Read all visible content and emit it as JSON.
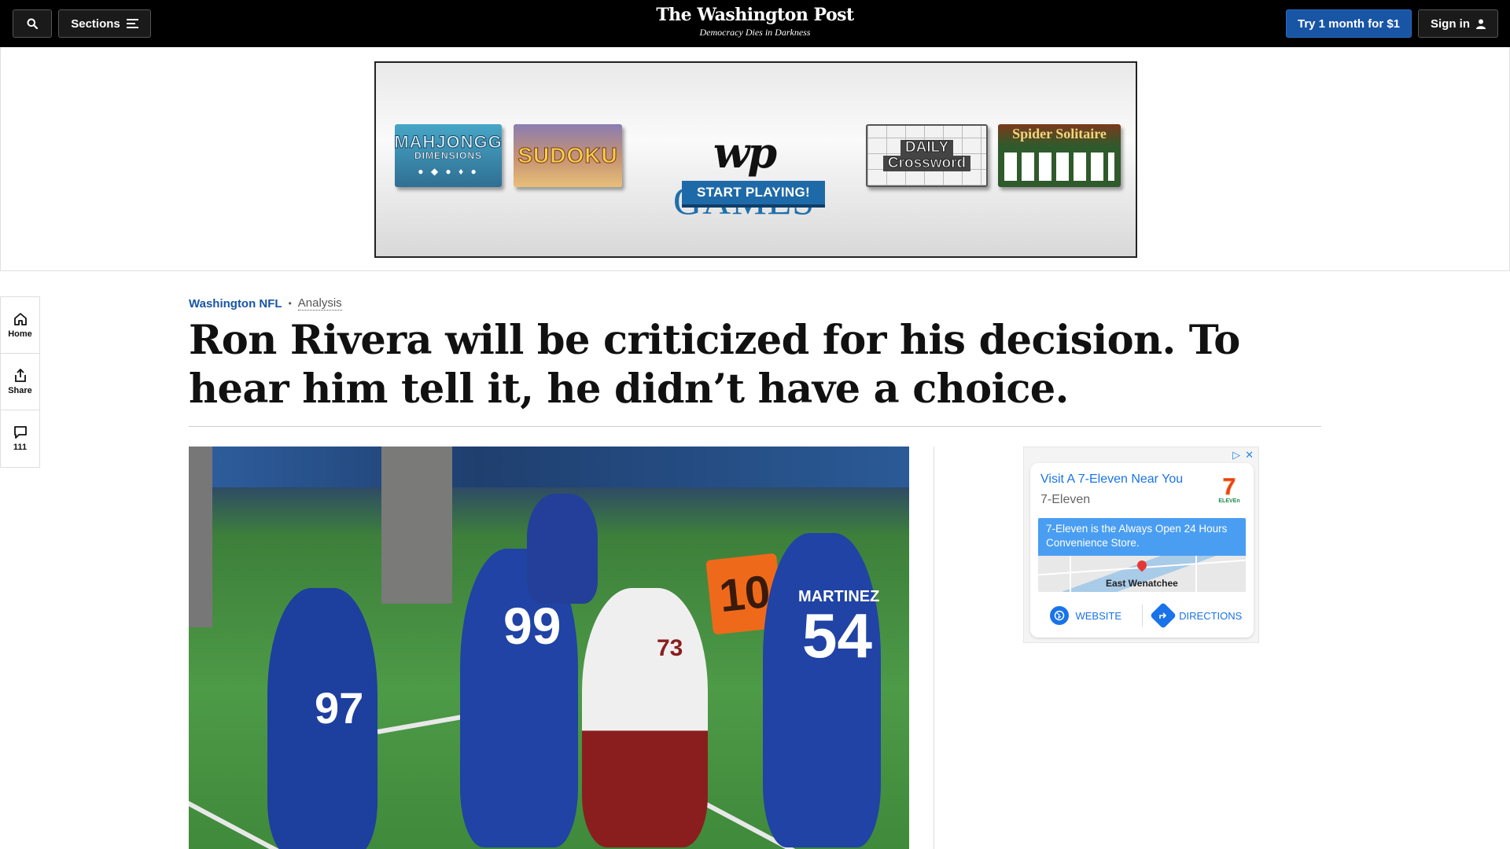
{
  "header": {
    "sections_label": "Sections",
    "logo_title": "The Washington Post",
    "logo_tagline": "Democracy Dies in Darkness",
    "subscribe_label": "Try 1 month for $1",
    "signin_label": "Sign in"
  },
  "games_ad": {
    "tile1_line1": "MAHJONGG",
    "tile1_line2": "DIMENSIONS",
    "tile2": "SUDOKU",
    "brand_mark": "wp",
    "brand_word": "GAMES",
    "cta": "START PLAYING!",
    "tile3_line1": "DAILY",
    "tile3_line2": "Crossword",
    "tile4": "Spider Solitaire"
  },
  "rail": {
    "home_label": "Home",
    "share_label": "Share",
    "comments_count": "111"
  },
  "article": {
    "section": "Washington NFL",
    "label": "Analysis",
    "headline": "Ron Rivera will be criticized for his decision. To hear him tell it, he didn’t have a choice."
  },
  "photo": {
    "marker": "10",
    "numbers": [
      "97",
      "99",
      "73",
      "54"
    ],
    "name_bar": "MARTINEZ"
  },
  "local_ad": {
    "title": "Visit A 7-Eleven Near You",
    "advertiser": "7-Eleven",
    "logo_top": "7",
    "logo_bottom": "ELEVEn",
    "description": "7-Eleven is the Always Open 24 Hours Convenience Store.",
    "map_city": "East Wenatchee",
    "website_label": "WEBSITE",
    "directions_label": "DIRECTIONS"
  },
  "colors": {
    "accent_blue": "#1955a5",
    "nav_bg": "#000000",
    "ad_blue": "#1a73e8"
  }
}
